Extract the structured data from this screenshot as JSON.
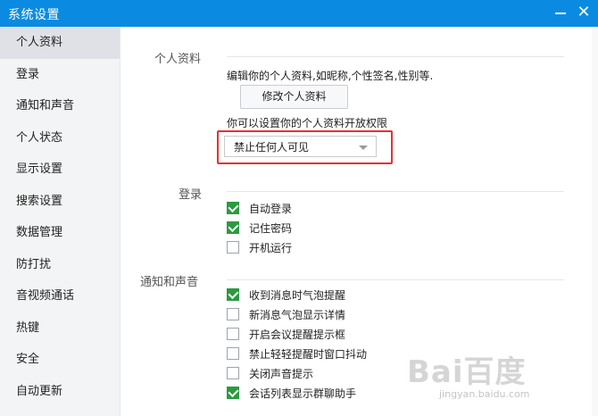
{
  "window": {
    "title": "系统设置",
    "minimize_label": "—",
    "close_label": "✕"
  },
  "sidebar": {
    "items": [
      {
        "label": "个人资料",
        "active": true
      },
      {
        "label": "登录"
      },
      {
        "label": "通知和声音"
      },
      {
        "label": "个人状态"
      },
      {
        "label": "显示设置"
      },
      {
        "label": "搜索设置"
      },
      {
        "label": "数据管理"
      },
      {
        "label": "防打扰"
      },
      {
        "label": "音视频通话"
      },
      {
        "label": "热键"
      },
      {
        "label": "安全"
      },
      {
        "label": "自动更新"
      }
    ]
  },
  "profile": {
    "section_title": "个人资料",
    "description": "编辑你的个人资料,如昵称,个性签名,性别等.",
    "edit_button": "修改个人资料",
    "permission_text": "你可以设置你的个人资料开放权限",
    "permission_select": "禁止任何人可见"
  },
  "login": {
    "section_title": "登录",
    "options": [
      {
        "label": "自动登录",
        "checked": true
      },
      {
        "label": "记住密码",
        "checked": true
      },
      {
        "label": "开机运行",
        "checked": false
      }
    ]
  },
  "notify": {
    "section_title": "通知和声音",
    "options": [
      {
        "label": "收到消息时气泡提醒",
        "checked": true
      },
      {
        "label": "新消息气泡显示详情",
        "checked": false
      },
      {
        "label": "开启会议提醒提示框",
        "checked": false
      },
      {
        "label": "禁止轻轻提醒时窗口抖动",
        "checked": false
      },
      {
        "label": "关闭声音提示",
        "checked": false
      },
      {
        "label": "会话列表显示群聊助手",
        "checked": true
      }
    ]
  },
  "watermark": {
    "logo": "Bai百度",
    "url": "jingyan.baidu.com"
  },
  "colors": {
    "titlebar": "#0a8be1",
    "checkbox_checked": "#2c9a3f",
    "highlight_border": "#ea2f2f"
  }
}
